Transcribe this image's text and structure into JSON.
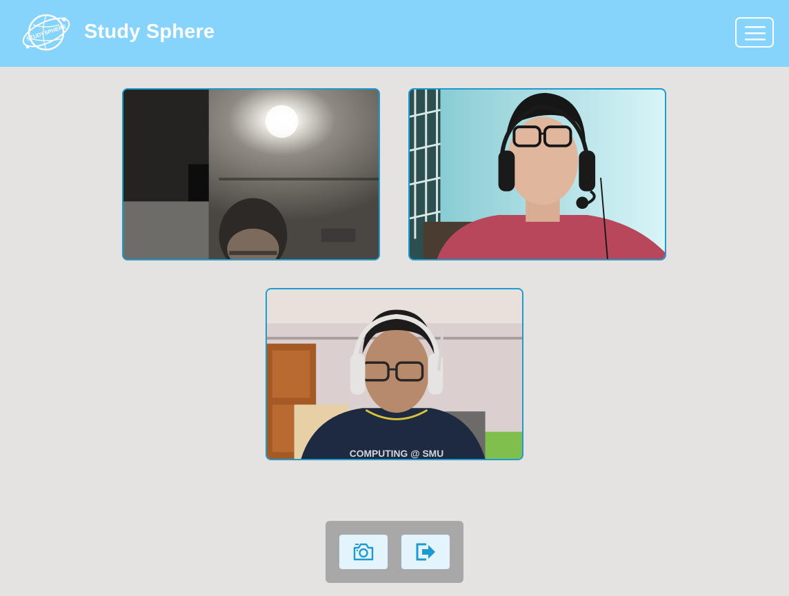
{
  "navbar": {
    "brand": "Study Sphere",
    "logo_text": "STUDYSPHERE",
    "bg_color": "#86d4fb",
    "menu_icon": "hamburger-menu-icon"
  },
  "videos": [
    {
      "participant": "participant-1",
      "scene": "dim room, overhead lamp"
    },
    {
      "participant": "participant-2",
      "scene": "headset, light blue wall"
    },
    {
      "participant": "participant-3",
      "shirt_text": "COMPUTING @ SMU"
    }
  ],
  "controls": {
    "camera_icon": "camera-icon",
    "leave_icon": "exit-icon",
    "icon_color": "#1c9bd3"
  },
  "colors": {
    "page_bg": "#e5e3e2",
    "video_border": "#1c9bd3",
    "controls_bg": "#a8a8a8",
    "button_bg": "#e4f4fd"
  }
}
